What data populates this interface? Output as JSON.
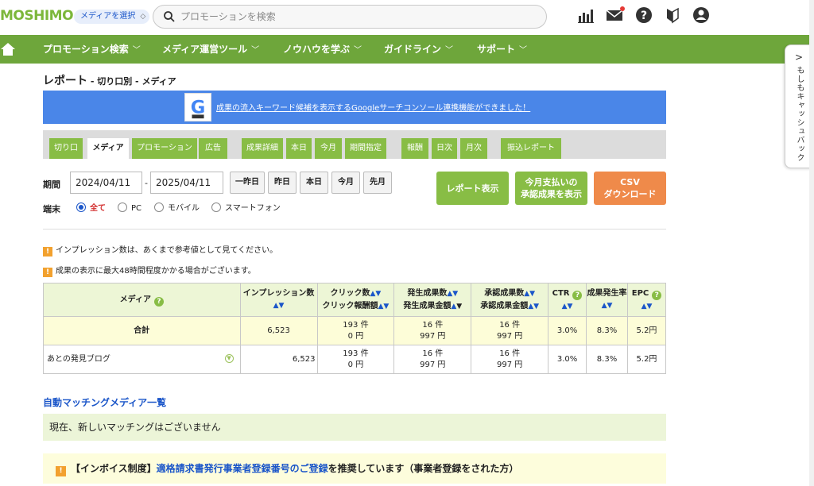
{
  "header": {
    "logo": "MOSHIMO",
    "media_select_label": "メディアを選択",
    "search_placeholder": "プロモーションを検索"
  },
  "nav": {
    "items": [
      {
        "label": "プロモーション検索"
      },
      {
        "label": "メディア運営ツール"
      },
      {
        "label": "ノウハウを学ぶ"
      },
      {
        "label": "ガイドライン"
      },
      {
        "label": "サポート"
      }
    ]
  },
  "sidetab": {
    "label": "もしもキャッシュバック"
  },
  "page": {
    "title": "レポート",
    "subtitle": " - 切り口別 - メディア"
  },
  "banner": {
    "text": "成果の流入キーワード候補を表示するGoogleサーチコンソール連携機能ができました！"
  },
  "tabs": {
    "group1": [
      "切り口",
      "メディア",
      "プロモーション",
      "広告"
    ],
    "group2": [
      "成果詳細",
      "本日",
      "今月",
      "期間指定"
    ],
    "group3": [
      "報酬",
      "日次",
      "月次"
    ],
    "group4": [
      "振込レポート"
    ]
  },
  "period": {
    "label": "期間",
    "from": "2024/04/11",
    "separator": "-",
    "to": "2025/04/11",
    "quick": [
      "一昨日",
      "昨日",
      "本日",
      "今月",
      "先月"
    ]
  },
  "device": {
    "label": "端末",
    "options": [
      "全て",
      "PC",
      "モバイル",
      "スマートフォン"
    ]
  },
  "actions": {
    "report_btn": "レポート表示",
    "monthly_btn_1": "今月支払いの",
    "monthly_btn_2": "承認成果を表示",
    "csv_btn_1": "CSV",
    "csv_btn_2": "ダウンロード"
  },
  "notices": [
    "インプレッション数は、あくまで参考値として見てください。",
    "成果の表示に最大48時間程度かかる場合がございます。"
  ],
  "table": {
    "headers": {
      "media": "メディア",
      "impressions": "インプレッション数",
      "clicks_1": "クリック数",
      "clicks_2": "クリック報酬額",
      "occurred_1": "発生成果数",
      "occurred_2": "発生成果金額",
      "approved_1": "承認成果数",
      "approved_2": "承認成果金額",
      "ctr": "CTR",
      "rate": "成果発生率",
      "epc": "EPC"
    },
    "total": {
      "label": "合計",
      "impressions": "6,523",
      "clicks": "193 件",
      "click_reward": "0 円",
      "occurred": "16 件",
      "occurred_amount": "997 円",
      "approved": "16 件",
      "approved_amount": "997 円",
      "ctr": "3.0%",
      "rate": "8.3%",
      "epc": "5.2円"
    },
    "rows": [
      {
        "media": "あとの発見ブログ",
        "impressions": "6,523",
        "clicks": "193 件",
        "click_reward": "0 円",
        "occurred": "16 件",
        "occurred_amount": "997 円",
        "approved": "16 件",
        "approved_amount": "997 円",
        "ctr": "3.0%",
        "rate": "8.3%",
        "epc": "5.2円"
      }
    ]
  },
  "auto_matching": {
    "link": "自動マッチングメディア一覧",
    "message": "現在、新しいマッチングはございません"
  },
  "invoice": {
    "prefix": "【インボイス制度】",
    "link": "適格請求書発行事業者登録番号のご登録",
    "suffix": "を推奨しています（事業者登録をされた方）"
  }
}
